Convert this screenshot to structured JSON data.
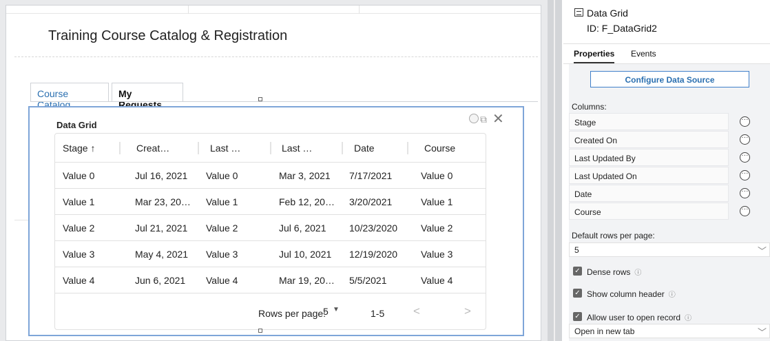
{
  "page": {
    "title": "Training Course Catalog & Registration",
    "tabs": [
      {
        "label": "Course Catalog"
      },
      {
        "label": "My Requests"
      }
    ]
  },
  "grid": {
    "title": "Data Grid",
    "controls": {
      "copy_glyph": "⧉",
      "close_glyph": "✕"
    },
    "columns": [
      "Stage ↑",
      "Creat…",
      "Last …",
      "Last …",
      "Date",
      "Course"
    ],
    "rows": [
      [
        "Value 0",
        "Jul 16, 2021",
        "Value 0",
        "Mar 3, 2021",
        "7/17/2021",
        "Value 0"
      ],
      [
        "Value 1",
        "Mar 23, 20…",
        "Value 1",
        "Feb 12, 20…",
        "3/20/2021",
        "Value 1"
      ],
      [
        "Value 2",
        "Jul 21, 2021",
        "Value 2",
        "Jul 6, 2021",
        "10/23/2020",
        "Value 2"
      ],
      [
        "Value 3",
        "May 4, 2021",
        "Value 3",
        "Jul 10, 2021",
        "12/19/2020",
        "Value 3"
      ],
      [
        "Value 4",
        "Jun 6, 2021",
        "Value 4",
        "Mar 19, 20…",
        "5/5/2021",
        "Value 4"
      ]
    ],
    "footer": {
      "rows_per_page_label": "Rows per page:",
      "rows_per_page_value": "5",
      "caret": "▼",
      "range": "1-5",
      "prev": "<",
      "next": ">"
    }
  },
  "panel": {
    "title": "Data Grid",
    "id": "ID: F_DataGrid2",
    "tabs": [
      {
        "label": "Properties"
      },
      {
        "label": "Events"
      }
    ],
    "configure_label": "Configure Data Source",
    "columns_label": "Columns:",
    "columns": [
      "Stage",
      "Created On",
      "Last Updated By",
      "Last Updated On",
      "Date",
      "Course"
    ],
    "more_glyph": "···",
    "rows_per_page_label": "Default rows per page:",
    "rows_per_page_value": "5",
    "select_caret": "﹀",
    "checkmark": "✓",
    "info_glyph": "ⓘ",
    "dense_rows": "Dense rows",
    "show_header": "Show column header",
    "allow_open": "Allow user to open record",
    "open_mode": "Open in new tab"
  }
}
